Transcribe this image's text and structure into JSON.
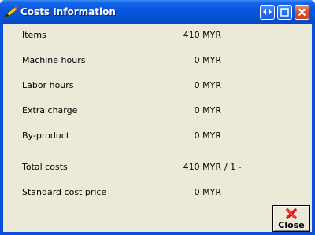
{
  "window": {
    "title": "Costs Information"
  },
  "rows": [
    {
      "label": "Items",
      "value": "410 MYR"
    },
    {
      "label": "Machine hours",
      "value": "0 MYR"
    },
    {
      "label": "Labor hours",
      "value": "0 MYR"
    },
    {
      "label": "Extra charge",
      "value": "0 MYR"
    },
    {
      "label": "By-product",
      "value": "0 MYR"
    }
  ],
  "totals": {
    "total_label": "Total costs",
    "total_value": "410 MYR",
    "total_extra": "/ 1 -",
    "standard_label": "Standard cost price",
    "standard_value": "0 MYR"
  },
  "footer": {
    "close_label": "Close"
  },
  "icons": {
    "app": "pencil-icon",
    "restore": "restore-arrows-icon",
    "maximize": "maximize-icon",
    "close": "close-icon",
    "close_button": "red-x-icon"
  }
}
